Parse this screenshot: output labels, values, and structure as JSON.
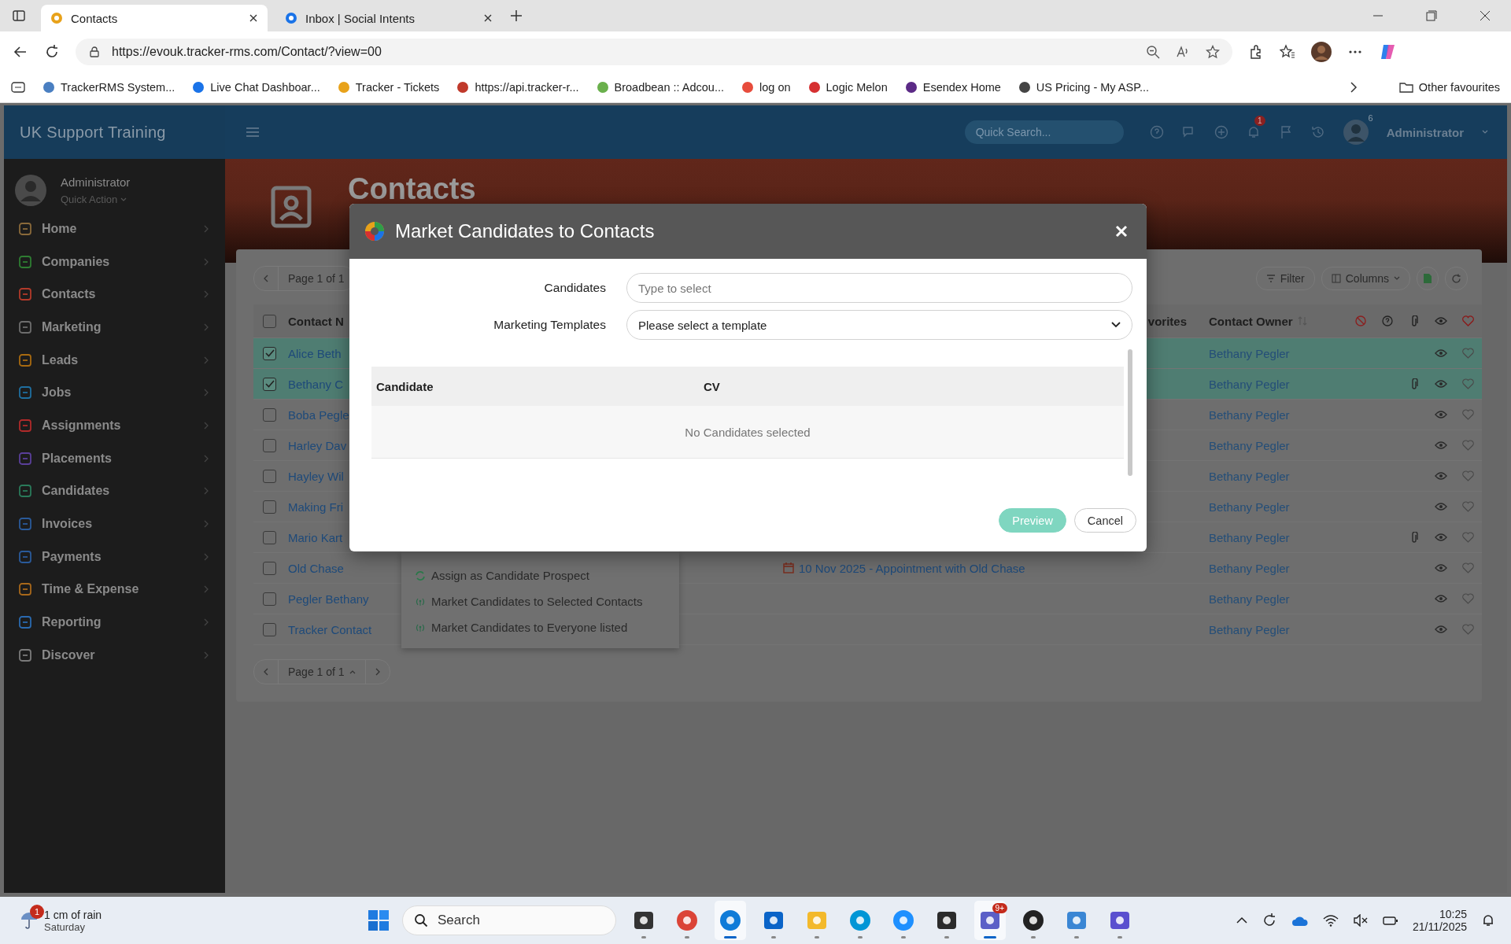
{
  "browser": {
    "tabs": [
      {
        "title": "Contacts",
        "selected": true
      },
      {
        "title": "Inbox | Social Intents",
        "selected": false
      }
    ],
    "url": "https://evouk.tracker-rms.com/Contact/?view=00",
    "bookmarks": [
      {
        "label": "TrackerRMS System...",
        "color": "#4a7fc1"
      },
      {
        "label": "Live Chat Dashboar...",
        "color": "#1a73e8"
      },
      {
        "label": "Tracker - Tickets",
        "color": "#e8a21a"
      },
      {
        "label": "https://api.tracker-r...",
        "color": "#c0392b"
      },
      {
        "label": "Broadbean :: Adcou...",
        "color": "#6ab04c"
      },
      {
        "label": "log on",
        "color": "#e74c3c"
      },
      {
        "label": "Logic Melon",
        "color": "#d63031"
      },
      {
        "label": "Esendex Home",
        "color": "#5b2a86"
      },
      {
        "label": "US Pricing - My ASP...",
        "color": "#444444"
      }
    ],
    "other_favourites": "Other favourites"
  },
  "app": {
    "brand": "UK Support Training",
    "header": {
      "search_placeholder": "Quick Search...",
      "notification_badge": "1",
      "avatar_badge": "6",
      "user": "Administrator"
    },
    "sidebar": {
      "user": "Administrator",
      "quick_action": "Quick Action",
      "items": [
        {
          "label": "Home",
          "color": "#8a6a3a"
        },
        {
          "label": "Companies",
          "color": "#2e7d32"
        },
        {
          "label": "Contacts",
          "color": "#b23a2a"
        },
        {
          "label": "Marketing",
          "color": "#6d6d6d"
        },
        {
          "label": "Leads",
          "color": "#a86a10"
        },
        {
          "label": "Jobs",
          "color": "#1f6fa0"
        },
        {
          "label": "Assignments",
          "color": "#b02a2a"
        },
        {
          "label": "Placements",
          "color": "#5a3f9a"
        },
        {
          "label": "Candidates",
          "color": "#2a7a5a"
        },
        {
          "label": "Invoices",
          "color": "#2a5a9a"
        },
        {
          "label": "Payments",
          "color": "#2a5a9a"
        },
        {
          "label": "Time & Expense",
          "color": "#a8681a"
        },
        {
          "label": "Reporting",
          "color": "#2a6ab0"
        },
        {
          "label": "Discover",
          "color": "#7a7a7a"
        }
      ]
    },
    "page_title": "Contacts",
    "pager": "Page 1 of 1",
    "toolbar": [
      "Filter",
      "Columns"
    ],
    "table": {
      "select_all_checked": false,
      "columns": [
        "Contact N",
        "vorites",
        "Contact Owner"
      ],
      "rows": [
        {
          "name": "Alice Beth",
          "checked": true,
          "owner": "Bethany Pegler",
          "attachment": false
        },
        {
          "name": "Bethany C",
          "checked": true,
          "owner": "Bethany Pegler",
          "attachment": true
        },
        {
          "name": "Boba Pegle",
          "checked": false,
          "owner": "Bethany Pegler",
          "attachment": false
        },
        {
          "name": "Harley Dav",
          "checked": false,
          "owner": "Bethany Pegler",
          "attachment": false
        },
        {
          "name": "Hayley Wil",
          "checked": false,
          "owner": "Bethany Pegler",
          "attachment": false
        },
        {
          "name": "Making Fri",
          "checked": false,
          "owner": "Bethany Pegler",
          "attachment": false
        },
        {
          "name": "Mario Kart",
          "checked": false,
          "owner": "Bethany Pegler",
          "attachment": true
        },
        {
          "name": "Old Chase",
          "checked": false,
          "appointment": "10 Nov 2025 - Appointment with Old Chase",
          "owner": "Bethany Pegler",
          "attachment": false
        },
        {
          "name": "Pegler Bethany",
          "checked": false,
          "owner": "Bethany Pegler",
          "attachment": false
        },
        {
          "name": "Tracker Contact",
          "checked": false,
          "owner": "Bethany Pegler",
          "attachment": false
        }
      ]
    },
    "bottom_pager": "Page 1 of 1",
    "context_menu": [
      {
        "label": "Assign as Candidate Prospect",
        "kind": "assign"
      },
      {
        "label": "Market Candidates to Selected Contacts",
        "kind": "market"
      },
      {
        "label": "Market Candidates to Everyone listed",
        "kind": "market"
      }
    ]
  },
  "modal": {
    "title": "Market Candidates to Contacts",
    "fields": [
      {
        "label": "Candidates",
        "placeholder": "Type to select",
        "kind": "text"
      },
      {
        "label": "Marketing Templates",
        "value": "Please select a template",
        "kind": "select"
      }
    ],
    "columns": [
      "Candidate",
      "CV"
    ],
    "empty": "No Candidates selected",
    "buttons": [
      {
        "label": "Preview",
        "kind": "primary"
      },
      {
        "label": "Cancel",
        "kind": "secondary"
      }
    ]
  },
  "taskbar": {
    "weather": {
      "text": "1 cm of rain",
      "day": "Saturday",
      "badge": "1"
    },
    "search_placeholder": "Search",
    "apps": [
      {
        "kind": "taskview",
        "active": false
      },
      {
        "kind": "chrome",
        "active": false
      },
      {
        "kind": "edge",
        "active": true
      },
      {
        "kind": "outlook",
        "active": false
      },
      {
        "kind": "explorer",
        "active": false
      },
      {
        "kind": "hp",
        "active": false
      },
      {
        "kind": "help",
        "active": false
      },
      {
        "kind": "sticky",
        "active": false
      },
      {
        "kind": "teams",
        "active": true,
        "badge": "9+"
      },
      {
        "kind": "media",
        "active": false
      },
      {
        "kind": "photos",
        "active": false
      },
      {
        "kind": "stack",
        "active": false
      }
    ],
    "time": "10:25",
    "date": "21/11/2025"
  }
}
